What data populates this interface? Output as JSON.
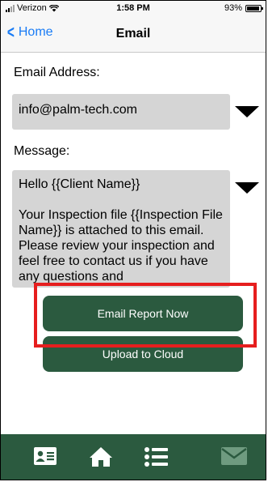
{
  "status_bar": {
    "carrier": "Verizon",
    "time": "1:58 PM",
    "battery_percent": "93%",
    "battery_level": 0.93
  },
  "nav": {
    "back_label": "Home",
    "title": "Email"
  },
  "form": {
    "email_label": "Email Address:",
    "email_value": "info@palm-tech.com",
    "message_label": "Message:",
    "message_greeting": "Hello {{Client Name}}",
    "message_body": "Your Inspection file {{Inspection File Name}} is attached to this email. Please review your inspection and feel free to contact us if you have any questions and"
  },
  "actions": {
    "email_report_label": "Email Report Now",
    "upload_label": "Upload to Cloud"
  },
  "tab_bar": {
    "icons": [
      "contact-card-icon",
      "home-icon",
      "list-icon",
      "mail-icon"
    ],
    "active_color": "#ffffff",
    "inactive_color": "#6f9b80"
  },
  "colors": {
    "accent_green": "#2b5a3f",
    "link_blue": "#1a7cf5",
    "highlight_red": "#e61e1e"
  }
}
